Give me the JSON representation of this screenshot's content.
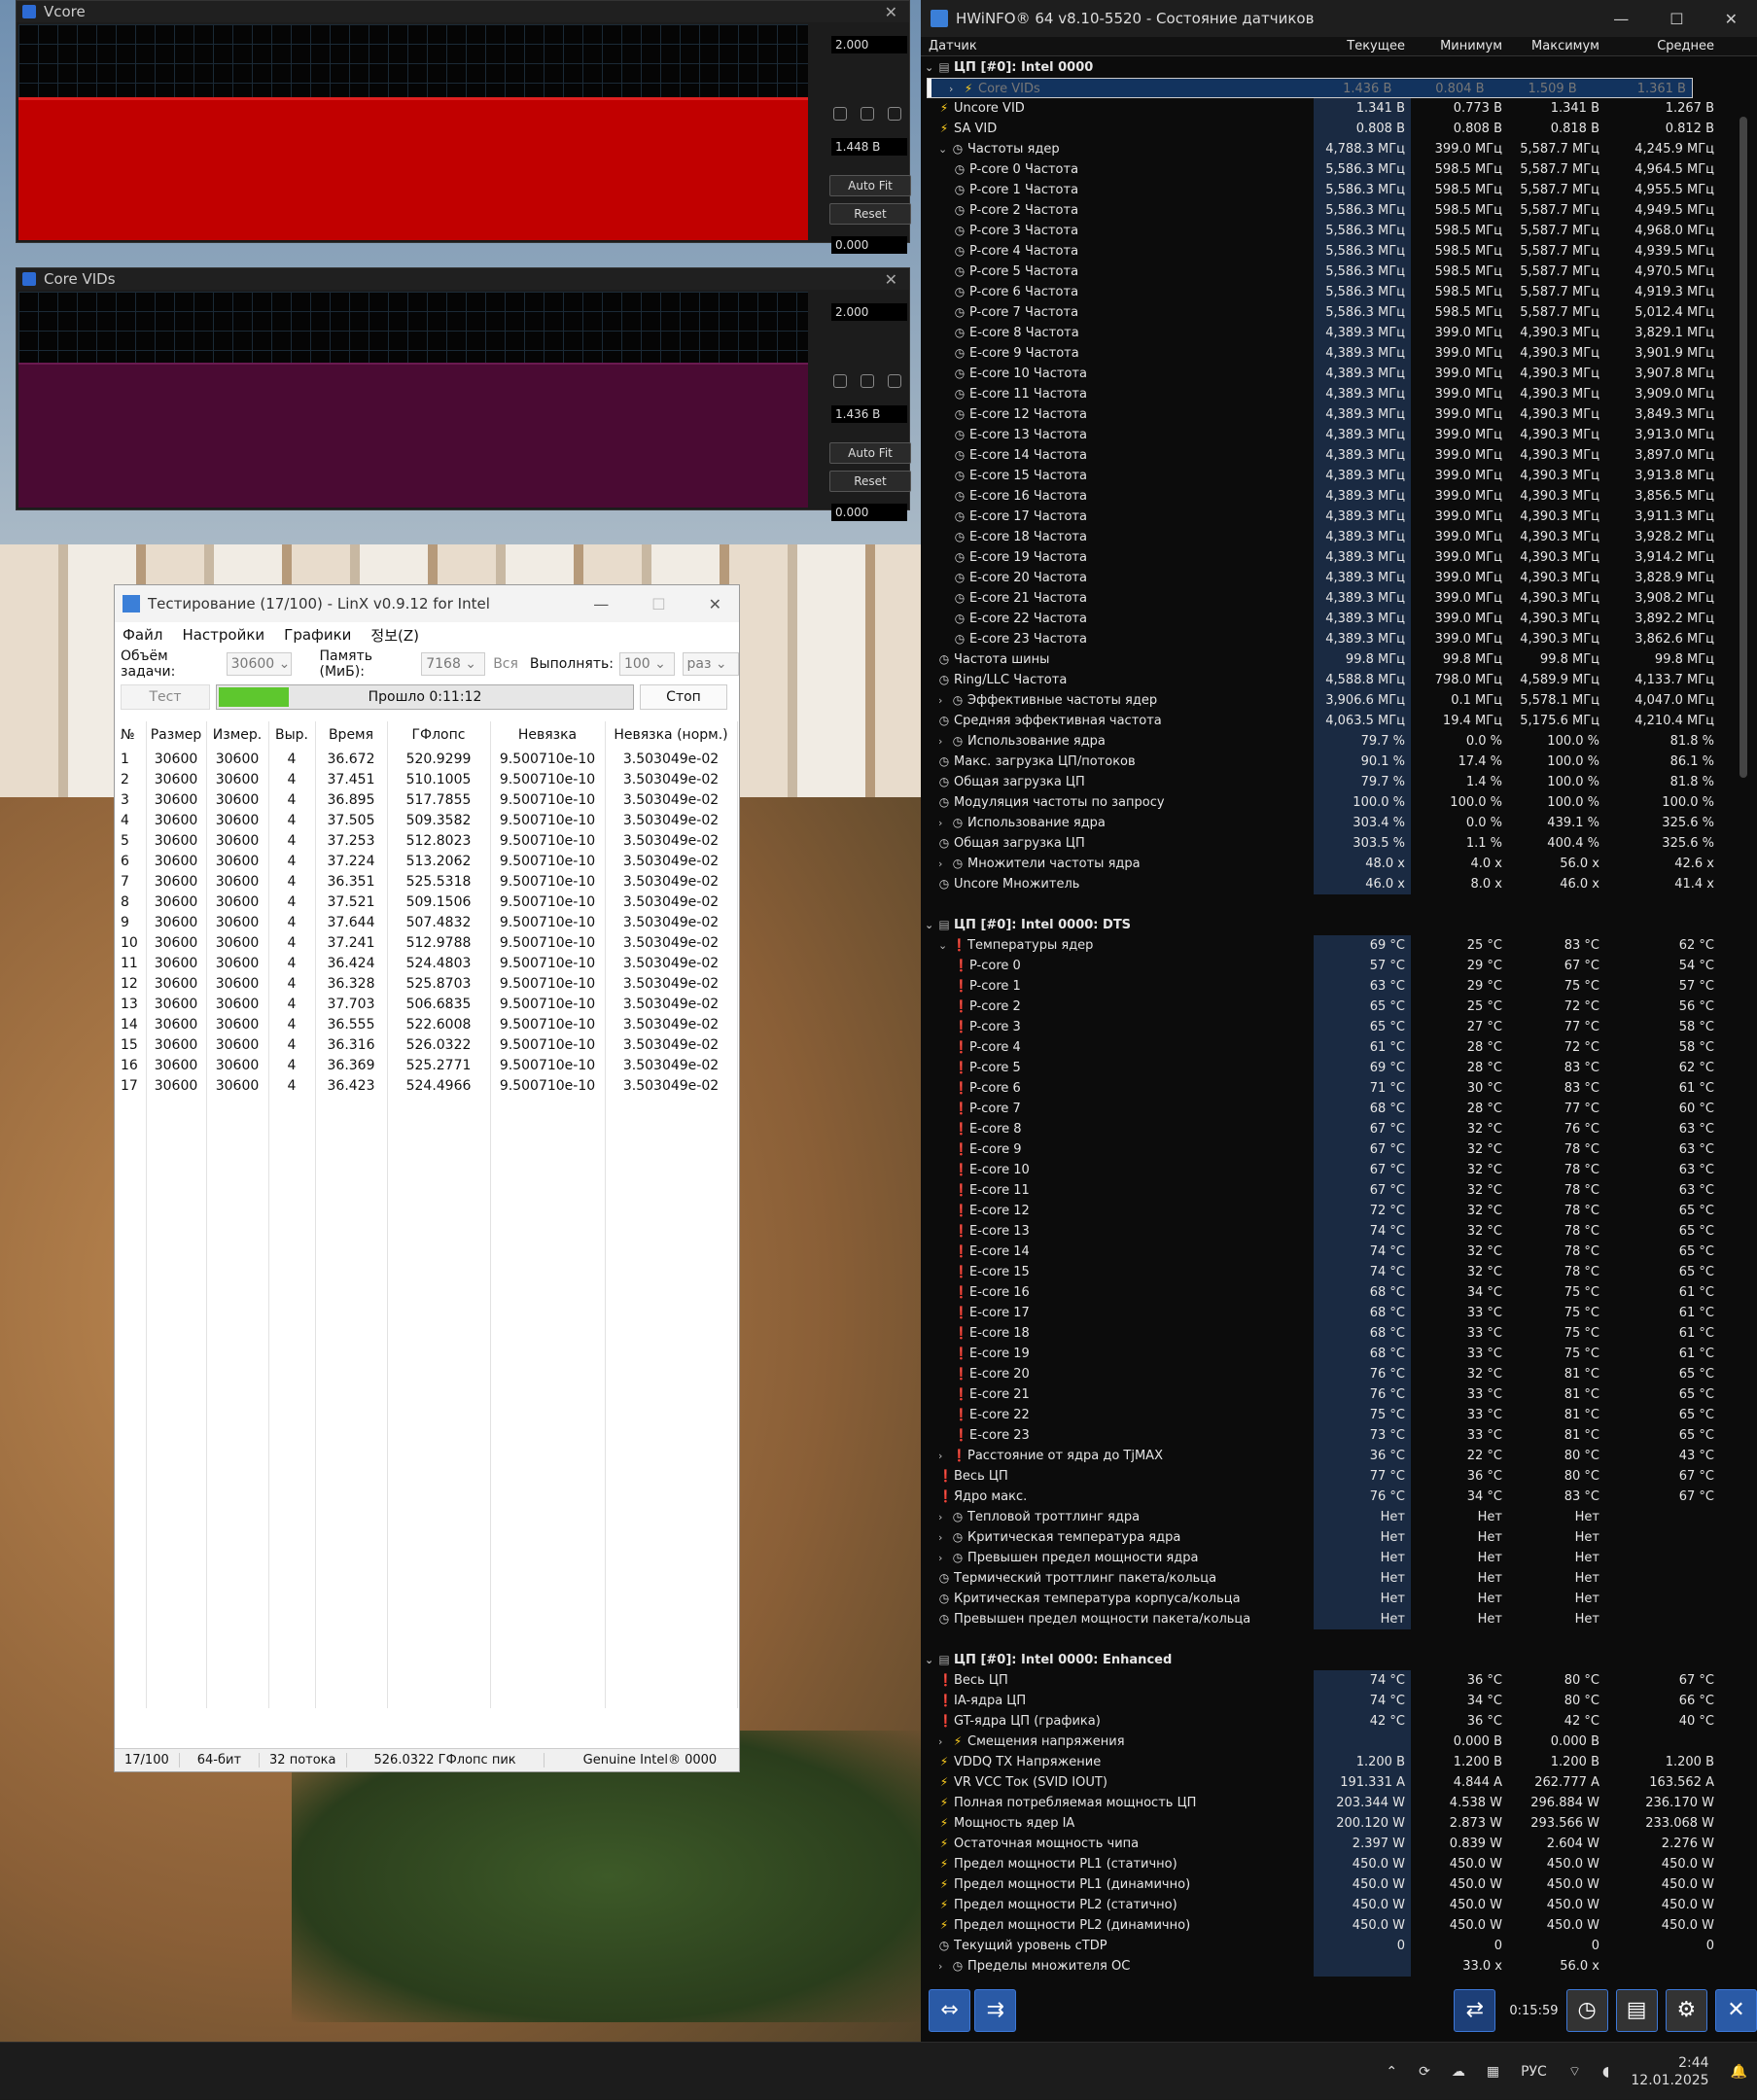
{
  "vcore": {
    "title": "Vcore",
    "max": "2.000",
    "cur": "1.448 В",
    "min": "0.000",
    "autofit": "Auto Fit",
    "reset": "Reset"
  },
  "corevid": {
    "title": "Core VIDs",
    "max": "2.000",
    "cur": "1.436 В",
    "min": "0.000",
    "autofit": "Auto Fit",
    "reset": "Reset"
  },
  "colors": {
    "vcore_fill": "#c10000",
    "vid_fill": "#4a0a33"
  },
  "linx": {
    "title": "Тестирование (17/100) - LinX v0.9.12 for Intel",
    "menu": [
      "Файл",
      "Настройки",
      "Графики",
      "정보(Z)"
    ],
    "size_label": "Объём задачи:",
    "size_val": "30600",
    "mem_label": "Память (МиБ):",
    "mem_val": "7168",
    "all_label": "Вся",
    "run_label": "Выполнять:",
    "run_val": "100",
    "times_label": "раз",
    "test_btn": "Тест",
    "elapsed": "Прошло 0:11:12",
    "stop_btn": "Стоп",
    "progress": 0.17,
    "headers": [
      "№",
      "Размер",
      "Измер.",
      "Выр.",
      "Время",
      "ГФлопс",
      "Невязка",
      "Невязка (норм.)"
    ],
    "rows": [
      [
        "1",
        "30600",
        "30600",
        "4",
        "36.672",
        "520.9299",
        "9.500710e-10",
        "3.503049e-02"
      ],
      [
        "2",
        "30600",
        "30600",
        "4",
        "37.451",
        "510.1005",
        "9.500710e-10",
        "3.503049e-02"
      ],
      [
        "3",
        "30600",
        "30600",
        "4",
        "36.895",
        "517.7855",
        "9.500710e-10",
        "3.503049e-02"
      ],
      [
        "4",
        "30600",
        "30600",
        "4",
        "37.505",
        "509.3582",
        "9.500710e-10",
        "3.503049e-02"
      ],
      [
        "5",
        "30600",
        "30600",
        "4",
        "37.253",
        "512.8023",
        "9.500710e-10",
        "3.503049e-02"
      ],
      [
        "6",
        "30600",
        "30600",
        "4",
        "37.224",
        "513.2062",
        "9.500710e-10",
        "3.503049e-02"
      ],
      [
        "7",
        "30600",
        "30600",
        "4",
        "36.351",
        "525.5318",
        "9.500710e-10",
        "3.503049e-02"
      ],
      [
        "8",
        "30600",
        "30600",
        "4",
        "37.521",
        "509.1506",
        "9.500710e-10",
        "3.503049e-02"
      ],
      [
        "9",
        "30600",
        "30600",
        "4",
        "37.644",
        "507.4832",
        "9.500710e-10",
        "3.503049e-02"
      ],
      [
        "10",
        "30600",
        "30600",
        "4",
        "37.241",
        "512.9788",
        "9.500710e-10",
        "3.503049e-02"
      ],
      [
        "11",
        "30600",
        "30600",
        "4",
        "36.424",
        "524.4803",
        "9.500710e-10",
        "3.503049e-02"
      ],
      [
        "12",
        "30600",
        "30600",
        "4",
        "36.328",
        "525.8703",
        "9.500710e-10",
        "3.503049e-02"
      ],
      [
        "13",
        "30600",
        "30600",
        "4",
        "37.703",
        "506.6835",
        "9.500710e-10",
        "3.503049e-02"
      ],
      [
        "14",
        "30600",
        "30600",
        "4",
        "36.555",
        "522.6008",
        "9.500710e-10",
        "3.503049e-02"
      ],
      [
        "15",
        "30600",
        "30600",
        "4",
        "36.316",
        "526.0322",
        "9.500710e-10",
        "3.503049e-02"
      ],
      [
        "16",
        "30600",
        "30600",
        "4",
        "36.369",
        "525.2771",
        "9.500710e-10",
        "3.503049e-02"
      ],
      [
        "17",
        "30600",
        "30600",
        "4",
        "36.423",
        "524.4966",
        "9.500710e-10",
        "3.503049e-02"
      ]
    ],
    "status": [
      "17/100",
      "64-бит",
      "32 потока",
      "526.0322 ГФлопс пик",
      "Genuine Intel® 0000"
    ]
  },
  "hw": {
    "title": "HWiNFO® 64 v8.10-5520 - Состояние датчиков",
    "headers": [
      "Датчик",
      "Текущее",
      "Минимум",
      "Максимум",
      "Среднее"
    ],
    "time": "0:15:59",
    "rows": [
      [
        "g",
        "ЦП [#0]: Intel 0000",
        "",
        "",
        "",
        ""
      ],
      [
        "bS",
        "Core VIDs",
        "1.436 В",
        "0.804 В",
        "1.509 В",
        "1.361 В"
      ],
      [
        "b",
        "Uncore VID",
        "1.341 В",
        "0.773 В",
        "1.341 В",
        "1.267 В"
      ],
      [
        "b",
        "SA VID",
        "0.808 В",
        "0.808 В",
        "0.818 В",
        "0.812 В"
      ],
      [
        "cE",
        "Частоты ядер",
        "4,788.3 МГц",
        "399.0 МГц",
        "5,587.7 МГц",
        "4,245.9 МГц"
      ],
      [
        "c2",
        "P-core 0 Частота",
        "5,586.3 МГц",
        "598.5 МГц",
        "5,587.7 МГц",
        "4,964.5 МГц"
      ],
      [
        "c2",
        "P-core 1 Частота",
        "5,586.3 МГц",
        "598.5 МГц",
        "5,587.7 МГц",
        "4,955.5 МГц"
      ],
      [
        "c2",
        "P-core 2 Частота",
        "5,586.3 МГц",
        "598.5 МГц",
        "5,587.7 МГц",
        "4,949.5 МГц"
      ],
      [
        "c2",
        "P-core 3 Частота",
        "5,586.3 МГц",
        "598.5 МГц",
        "5,587.7 МГц",
        "4,968.0 МГц"
      ],
      [
        "c2",
        "P-core 4 Частота",
        "5,586.3 МГц",
        "598.5 МГц",
        "5,587.7 МГц",
        "4,939.5 МГц"
      ],
      [
        "c2",
        "P-core 5 Частота",
        "5,586.3 МГц",
        "598.5 МГц",
        "5,587.7 МГц",
        "4,970.5 МГц"
      ],
      [
        "c2",
        "P-core 6 Частота",
        "5,586.3 МГц",
        "598.5 МГц",
        "5,587.7 МГц",
        "4,919.3 МГц"
      ],
      [
        "c2",
        "P-core 7 Частота",
        "5,586.3 МГц",
        "598.5 МГц",
        "5,587.7 МГц",
        "5,012.4 МГц"
      ],
      [
        "c2",
        "E-core 8 Частота",
        "4,389.3 МГц",
        "399.0 МГц",
        "4,390.3 МГц",
        "3,829.1 МГц"
      ],
      [
        "c2",
        "E-core 9 Частота",
        "4,389.3 МГц",
        "399.0 МГц",
        "4,390.3 МГц",
        "3,901.9 МГц"
      ],
      [
        "c2",
        "E-core 10 Частота",
        "4,389.3 МГц",
        "399.0 МГц",
        "4,390.3 МГц",
        "3,907.8 МГц"
      ],
      [
        "c2",
        "E-core 11 Частота",
        "4,389.3 МГц",
        "399.0 МГц",
        "4,390.3 МГц",
        "3,909.0 МГц"
      ],
      [
        "c2",
        "E-core 12 Частота",
        "4,389.3 МГц",
        "399.0 МГц",
        "4,390.3 МГц",
        "3,849.3 МГц"
      ],
      [
        "c2",
        "E-core 13 Частота",
        "4,389.3 МГц",
        "399.0 МГц",
        "4,390.3 МГц",
        "3,913.0 МГц"
      ],
      [
        "c2",
        "E-core 14 Частота",
        "4,389.3 МГц",
        "399.0 МГц",
        "4,390.3 МГц",
        "3,897.0 МГц"
      ],
      [
        "c2",
        "E-core 15 Частота",
        "4,389.3 МГц",
        "399.0 МГц",
        "4,390.3 МГц",
        "3,913.8 МГц"
      ],
      [
        "c2",
        "E-core 16 Частота",
        "4,389.3 МГц",
        "399.0 МГц",
        "4,390.3 МГц",
        "3,856.5 МГц"
      ],
      [
        "c2",
        "E-core 17 Частота",
        "4,389.3 МГц",
        "399.0 МГц",
        "4,390.3 МГц",
        "3,911.3 МГц"
      ],
      [
        "c2",
        "E-core 18 Частота",
        "4,389.3 МГц",
        "399.0 МГц",
        "4,390.3 МГц",
        "3,928.2 МГц"
      ],
      [
        "c2",
        "E-core 19 Частота",
        "4,389.3 МГц",
        "399.0 МГц",
        "4,390.3 МГц",
        "3,914.2 МГц"
      ],
      [
        "c2",
        "E-core 20 Частота",
        "4,389.3 МГц",
        "399.0 МГц",
        "4,390.3 МГц",
        "3,828.9 МГц"
      ],
      [
        "c2",
        "E-core 21 Частота",
        "4,389.3 МГц",
        "399.0 МГц",
        "4,390.3 МГц",
        "3,908.2 МГц"
      ],
      [
        "c2",
        "E-core 22 Частота",
        "4,389.3 МГц",
        "399.0 МГц",
        "4,390.3 МГц",
        "3,892.2 МГц"
      ],
      [
        "c2",
        "E-core 23 Частота",
        "4,389.3 МГц",
        "399.0 МГц",
        "4,390.3 МГц",
        "3,862.6 МГц"
      ],
      [
        "c",
        "Частота шины",
        "99.8 МГц",
        "99.8 МГц",
        "99.8 МГц",
        "99.8 МГц"
      ],
      [
        "c",
        "Ring/LLC Частота",
        "4,588.8 МГц",
        "798.0 МГц",
        "4,589.9 МГц",
        "4,133.7 МГц"
      ],
      [
        "cC",
        "Эффективные частоты ядер",
        "3,906.6 МГц",
        "0.1 МГц",
        "5,578.1 МГц",
        "4,047.0 МГц"
      ],
      [
        "c",
        "Средняя эффективная частота",
        "4,063.5 МГц",
        "19.4 МГц",
        "5,175.6 МГц",
        "4,210.4 МГц"
      ],
      [
        "cC",
        "Использование ядра",
        "79.7 %",
        "0.0 %",
        "100.0 %",
        "81.8 %"
      ],
      [
        "c",
        "Макс. загрузка ЦП/потоков",
        "90.1 %",
        "17.4 %",
        "100.0 %",
        "86.1 %"
      ],
      [
        "c",
        "Общая загрузка ЦП",
        "79.7 %",
        "1.4 %",
        "100.0 %",
        "81.8 %"
      ],
      [
        "c",
        "Модуляция частоты по запросу",
        "100.0 %",
        "100.0 %",
        "100.0 %",
        "100.0 %"
      ],
      [
        "cC",
        "Использование ядра",
        "303.4 %",
        "0.0 %",
        "439.1 %",
        "325.6 %"
      ],
      [
        "c",
        "Общая загрузка ЦП",
        "303.5 %",
        "1.1 %",
        "400.4 %",
        "325.6 %"
      ],
      [
        "cC",
        "Множители частоты ядра",
        "48.0 x",
        "4.0 x",
        "56.0 x",
        "42.6 x"
      ],
      [
        "c",
        "Uncore Множитель",
        "46.0 x",
        "8.0 x",
        "46.0 x",
        "41.4 x"
      ],
      [
        "e",
        "",
        "",
        "",
        "",
        ""
      ],
      [
        "g",
        "ЦП [#0]: Intel 0000: DTS",
        "",
        "",
        "",
        ""
      ],
      [
        "tE",
        "Температуры ядер",
        "69 °C",
        "25 °C",
        "83 °C",
        "62 °C"
      ],
      [
        "t2",
        "P-core 0",
        "57 °C",
        "29 °C",
        "67 °C",
        "54 °C"
      ],
      [
        "t2",
        "P-core 1",
        "63 °C",
        "29 °C",
        "75 °C",
        "57 °C"
      ],
      [
        "t2",
        "P-core 2",
        "65 °C",
        "25 °C",
        "72 °C",
        "56 °C"
      ],
      [
        "t2",
        "P-core 3",
        "65 °C",
        "27 °C",
        "77 °C",
        "58 °C"
      ],
      [
        "t2",
        "P-core 4",
        "61 °C",
        "28 °C",
        "72 °C",
        "58 °C"
      ],
      [
        "t2",
        "P-core 5",
        "69 °C",
        "28 °C",
        "83 °C",
        "62 °C"
      ],
      [
        "t2",
        "P-core 6",
        "71 °C",
        "30 °C",
        "83 °C",
        "61 °C"
      ],
      [
        "t2",
        "P-core 7",
        "68 °C",
        "28 °C",
        "77 °C",
        "60 °C"
      ],
      [
        "t2",
        "E-core 8",
        "67 °C",
        "32 °C",
        "76 °C",
        "63 °C"
      ],
      [
        "t2",
        "E-core 9",
        "67 °C",
        "32 °C",
        "78 °C",
        "63 °C"
      ],
      [
        "t2",
        "E-core 10",
        "67 °C",
        "32 °C",
        "78 °C",
        "63 °C"
      ],
      [
        "t2",
        "E-core 11",
        "67 °C",
        "32 °C",
        "78 °C",
        "63 °C"
      ],
      [
        "t2",
        "E-core 12",
        "72 °C",
        "32 °C",
        "78 °C",
        "65 °C"
      ],
      [
        "t2",
        "E-core 13",
        "74 °C",
        "32 °C",
        "78 °C",
        "65 °C"
      ],
      [
        "t2",
        "E-core 14",
        "74 °C",
        "32 °C",
        "78 °C",
        "65 °C"
      ],
      [
        "t2",
        "E-core 15",
        "74 °C",
        "32 °C",
        "78 °C",
        "65 °C"
      ],
      [
        "t2",
        "E-core 16",
        "68 °C",
        "34 °C",
        "75 °C",
        "61 °C"
      ],
      [
        "t2",
        "E-core 17",
        "68 °C",
        "33 °C",
        "75 °C",
        "61 °C"
      ],
      [
        "t2",
        "E-core 18",
        "68 °C",
        "33 °C",
        "75 °C",
        "61 °C"
      ],
      [
        "t2",
        "E-core 19",
        "68 °C",
        "33 °C",
        "75 °C",
        "61 °C"
      ],
      [
        "t2",
        "E-core 20",
        "76 °C",
        "32 °C",
        "81 °C",
        "65 °C"
      ],
      [
        "t2",
        "E-core 21",
        "76 °C",
        "33 °C",
        "81 °C",
        "65 °C"
      ],
      [
        "t2",
        "E-core 22",
        "75 °C",
        "33 °C",
        "81 °C",
        "65 °C"
      ],
      [
        "t2",
        "E-core 23",
        "73 °C",
        "33 °C",
        "81 °C",
        "65 °C"
      ],
      [
        "tC",
        "Расстояние от ядра до TjMAX",
        "36 °C",
        "22 °C",
        "80 °C",
        "43 °C"
      ],
      [
        "t",
        "Весь ЦП",
        "77 °C",
        "36 °C",
        "80 °C",
        "67 °C"
      ],
      [
        "t",
        "Ядро макс.",
        "76 °C",
        "34 °C",
        "83 °C",
        "67 °C"
      ],
      [
        "cC",
        "Тепловой троттлинг ядра",
        "Нет",
        "Нет",
        "Нет",
        ""
      ],
      [
        "cC",
        "Критическая температура ядра",
        "Нет",
        "Нет",
        "Нет",
        ""
      ],
      [
        "cC",
        "Превышен предел мощности ядра",
        "Нет",
        "Нет",
        "Нет",
        ""
      ],
      [
        "c",
        "Термический троттлинг пакета/кольца",
        "Нет",
        "Нет",
        "Нет",
        ""
      ],
      [
        "c",
        "Критическая температура корпуса/кольца",
        "Нет",
        "Нет",
        "Нет",
        ""
      ],
      [
        "c",
        "Превышен предел мощности пакета/кольца",
        "Нет",
        "Нет",
        "Нет",
        ""
      ],
      [
        "e",
        "",
        "",
        "",
        "",
        ""
      ],
      [
        "g",
        "ЦП [#0]: Intel 0000: Enhanced",
        "",
        "",
        "",
        ""
      ],
      [
        "t",
        "Весь ЦП",
        "74 °C",
        "36 °C",
        "80 °C",
        "67 °C"
      ],
      [
        "t",
        "IA-ядра ЦП",
        "74 °C",
        "34 °C",
        "80 °C",
        "66 °C"
      ],
      [
        "t",
        "GT-ядра ЦП (графика)",
        "42 °C",
        "36 °C",
        "42 °C",
        "40 °C"
      ],
      [
        "bC",
        "Смещения напряжения",
        "",
        "0.000 В",
        "0.000 В",
        ""
      ],
      [
        "b",
        "VDDQ TX Напряжение",
        "1.200 В",
        "1.200 В",
        "1.200 В",
        "1.200 В"
      ],
      [
        "b",
        "VR VCC Ток (SVID IOUT)",
        "191.331 A",
        "4.844 A",
        "262.777 A",
        "163.562 A"
      ],
      [
        "b",
        "Полная потребляемая мощность ЦП",
        "203.344 W",
        "4.538 W",
        "296.884 W",
        "236.170 W"
      ],
      [
        "b",
        "Мощность ядер IA",
        "200.120 W",
        "2.873 W",
        "293.566 W",
        "233.068 W"
      ],
      [
        "b",
        "Остаточная мощность чипа",
        "2.397 W",
        "0.839 W",
        "2.604 W",
        "2.276 W"
      ],
      [
        "b",
        "Предел мощности PL1 (статично)",
        "450.0 W",
        "450.0 W",
        "450.0 W",
        "450.0 W"
      ],
      [
        "b",
        "Предел мощности PL1 (динамично)",
        "450.0 W",
        "450.0 W",
        "450.0 W",
        "450.0 W"
      ],
      [
        "b",
        "Предел мощности PL2 (статично)",
        "450.0 W",
        "450.0 W",
        "450.0 W",
        "450.0 W"
      ],
      [
        "b",
        "Предел мощности PL2 (динамично)",
        "450.0 W",
        "450.0 W",
        "450.0 W",
        "450.0 W"
      ],
      [
        "c",
        "Текущий уровень cTDP",
        "0",
        "0",
        "0",
        "0"
      ],
      [
        "cC",
        "Пределы множителя ОС",
        "",
        "33.0 x",
        "56.0 x",
        ""
      ]
    ]
  },
  "taskbar": {
    "lang": "РУС",
    "time": "2:44",
    "date": "12.01.2025"
  }
}
